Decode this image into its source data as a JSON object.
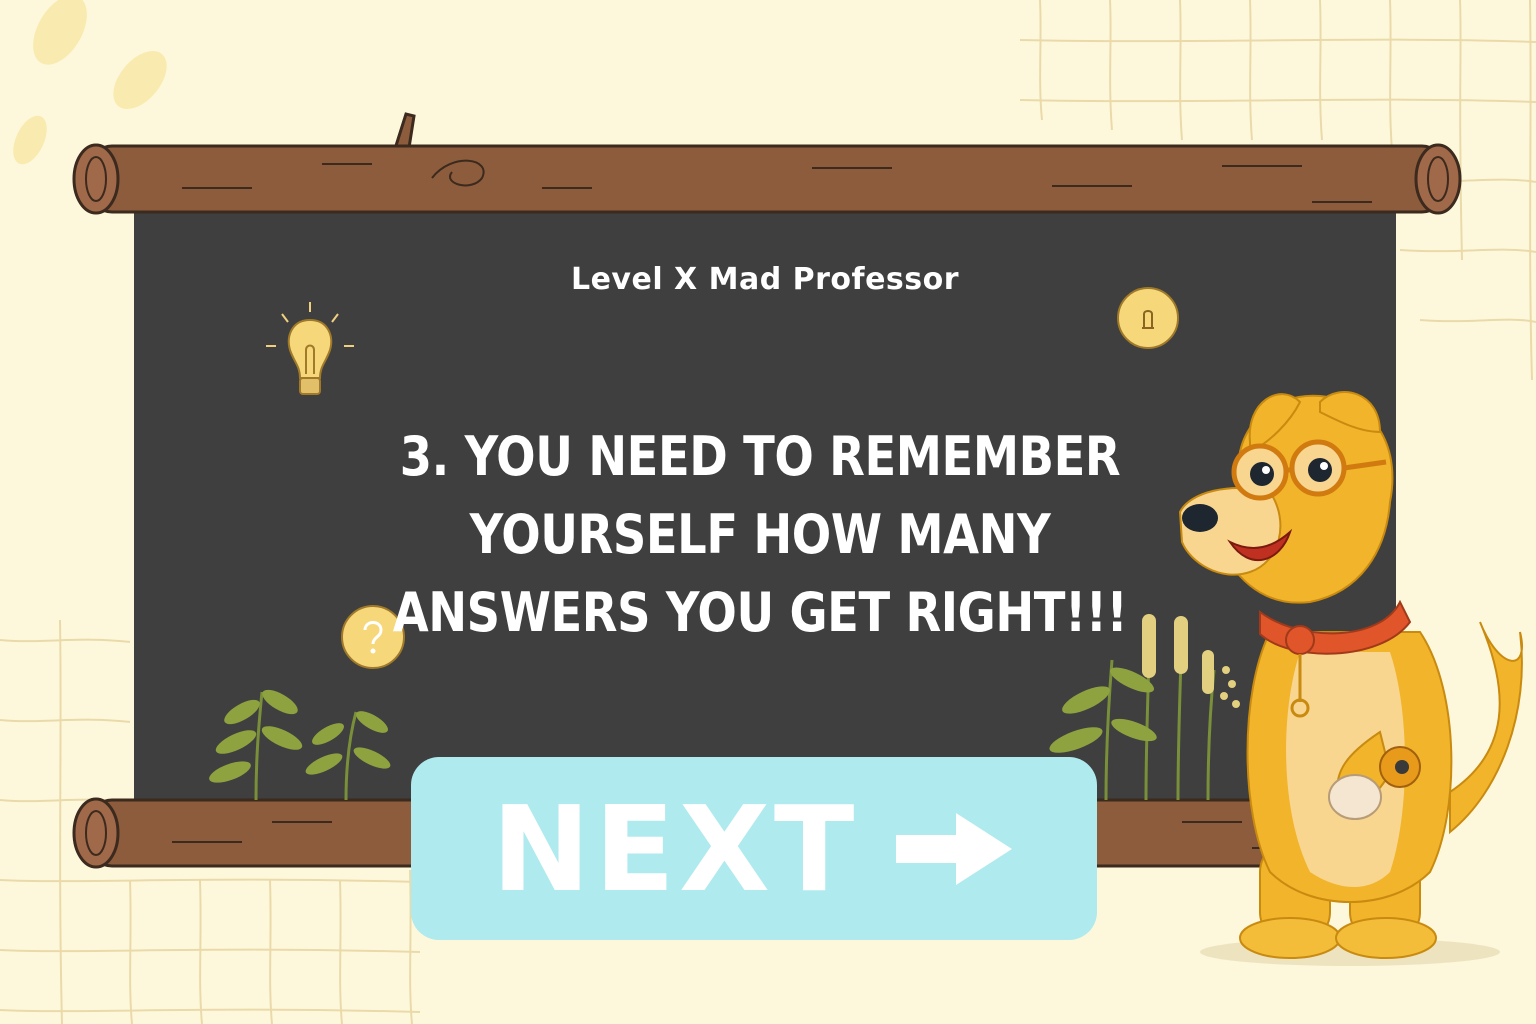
{
  "board": {
    "level_title": "Level X Mad Professor",
    "question": "3. You need to remember yourself how many answers you get right!!!"
  },
  "next_button": {
    "label": "NEXT",
    "icon": "arrow-right-icon"
  },
  "decorations": {
    "icons": [
      "lightbulb-icon",
      "lightbulb-coin-icon",
      "question-coin-icon",
      "plant-icon",
      "reed-icon"
    ]
  },
  "mascot": {
    "icon": "dog-professor-mascot"
  },
  "colors": {
    "background": "#fdf8dc",
    "board": "#3e3f3e",
    "wood": "#8d5c3c",
    "button": "#aeeaee",
    "text": "#ffffff",
    "dog": "#f1b42a"
  }
}
